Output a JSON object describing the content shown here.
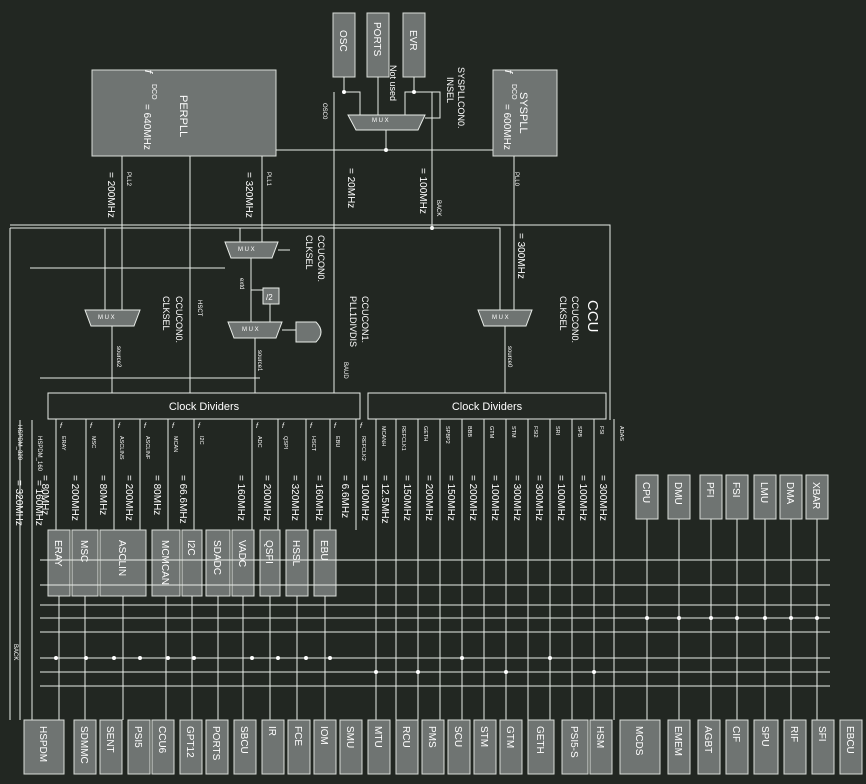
{
  "ccu_label": "CCU",
  "sources": [
    {
      "name": "osc",
      "label": "OSC"
    },
    {
      "name": "ports",
      "label": "PORTS"
    },
    {
      "name": "evr",
      "label": "EVR"
    }
  ],
  "perpll": {
    "label": "PERPLL",
    "freq": "= 640MHz",
    "sym": "f",
    "sub": "DCO"
  },
  "syspll": {
    "label": "SYSPLL",
    "freq": "= 600MHz",
    "sym": "f",
    "sub": "DCO"
  },
  "labels": {
    "not_used": "Not used",
    "syspllcon0": "SYSPLLCON0.",
    "insel": "INSEL",
    "fosc0": "OSC0",
    "fpll2": "PLL2",
    "fpll1": "PLL1",
    "fpll0": "PLL0",
    "fback": "BACK",
    "fsrc0": "source0",
    "fsrc1": "source1",
    "fsrc2": "source2",
    "fhsct": "HSCT",
    "fextl": "extd",
    "fbaud": "BAUD",
    "ccucon0_clksel_a": "CCUCON0.",
    "ccucon0_clksel_b": "CLKSEL",
    "ccucon1": "CCUCON1.",
    "pll1divdis": "PLL1DIVDIS",
    "div2": "/2",
    "fhspdm320": "HSPDM_320",
    "fhspdm160": "HSPDM_160",
    "fback_bottom": "BACK"
  },
  "freqs": {
    "f200": "= 200MHz",
    "f320": "= 320MHz",
    "f20": "= 20MHz",
    "f100": "= 100MHz",
    "f300": "= 300MHz",
    "fhspdm320": "= 320MHz",
    "fhspdm160": "= 160MHz"
  },
  "dividers": [
    "Clock Dividers",
    "Clock Dividers"
  ],
  "left_clocks": [
    {
      "sub": "ERAY",
      "freq": "= 80MHz"
    },
    {
      "sub": "MSC",
      "freq": "= 200MHz"
    },
    {
      "sub": "ASCLINS",
      "freq": "= 80MHz"
    },
    {
      "sub": "ASCLINF",
      "freq": "= 200MHz"
    },
    {
      "sub": "MCAN",
      "freq": "= 80MHz"
    },
    {
      "sub": "I2C",
      "freq": "= 66.6MHz"
    },
    {
      "sub": "ADC",
      "freq": "= 160MHz"
    },
    {
      "sub": "QSPI",
      "freq": "= 200MHz"
    },
    {
      "sub": "HSCT",
      "freq": "= 320MHz"
    },
    {
      "sub": "EBU",
      "freq": "= 160MHz"
    },
    {
      "sub": "REFCLK2",
      "freq": "= 6.6MHz"
    }
  ],
  "right_clocks": [
    {
      "sub": "MCANH",
      "freq": "= 100MHz"
    },
    {
      "sub": "REFCLK1",
      "freq": "= 12.5MHz"
    },
    {
      "sub": "GETH",
      "freq": "= 150MHz"
    },
    {
      "sub": "SPBP2",
      "freq": "= 200MHz"
    },
    {
      "sub": "BBB",
      "freq": "= 150MHz"
    },
    {
      "sub": "GTM",
      "freq": "= 200MHz"
    },
    {
      "sub": "STM",
      "freq": "= 100MHz"
    },
    {
      "sub": "FSI2",
      "freq": "= 300MHz"
    },
    {
      "sub": "SRI",
      "freq": "= 300MHz"
    },
    {
      "sub": "SPB",
      "freq": "= 100MHz"
    },
    {
      "sub": "FSI",
      "freq": "= 100MHz"
    },
    {
      "sub": "ADAS",
      "freq": "= 300MHz"
    }
  ],
  "mid_blocks": [
    "ERAY",
    "MSC",
    "ASCLIN",
    "MCMCAN",
    "I2C",
    "SDADC",
    "VADC",
    "QSPI",
    "HSSL",
    "EBU"
  ],
  "top_right_blocks": [
    "CPU",
    "DMU",
    "PFI",
    "FSI",
    "LMU",
    "DMA",
    "XBAR"
  ],
  "bottom_blocks": [
    "HSPDM",
    "SDMMC",
    "SENT",
    "PSI5",
    "CCU6",
    "GPT12",
    "PORTS",
    "SBCU",
    "IR",
    "FCE",
    "IOM",
    "SMU",
    "MTU",
    "RCU",
    "PMS",
    "SCU",
    "STM",
    "GTM",
    "GETH",
    "PSI5-S",
    "HSM",
    "MCDS",
    "EMEM",
    "AGBT",
    "CIF",
    "SPU",
    "RIF",
    "SFI",
    "EBCU"
  ]
}
